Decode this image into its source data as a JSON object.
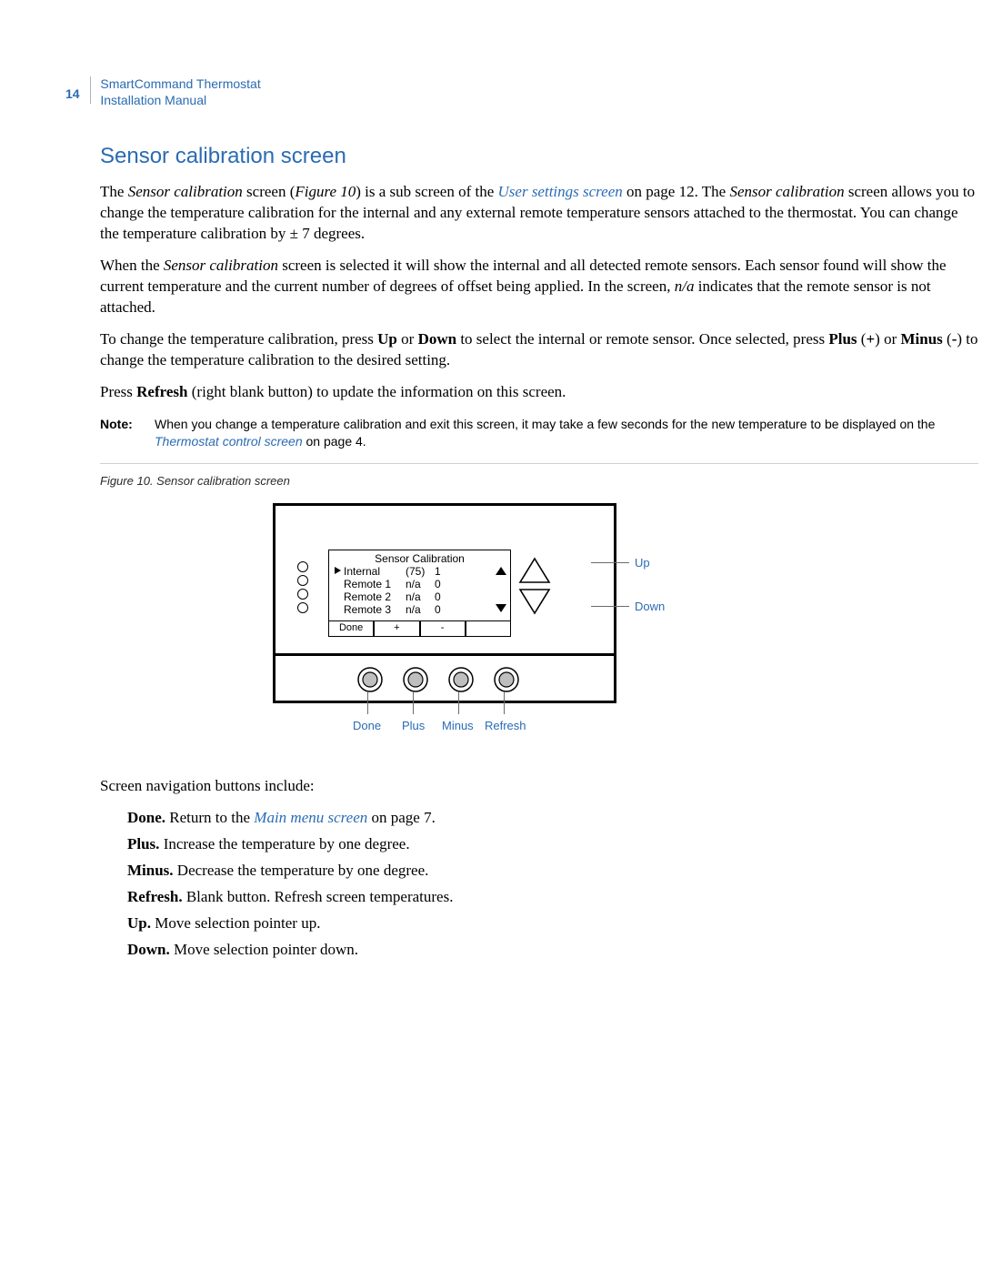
{
  "header": {
    "page_number": "14",
    "product": "SmartCommand Thermostat",
    "doc_title": "Installation Manual"
  },
  "section_title": "Sensor calibration screen",
  "para1": {
    "a": "The ",
    "i1": "Sensor calibration",
    "b": " screen (",
    "i2": "Figure 10",
    "c": ") is a sub screen of the ",
    "link": "User settings screen",
    "d": " on page 12. The ",
    "i3": "Sensor calibration",
    "e": " screen allows you to change the temperature calibration for the internal and any external remote temperature sensors attached to the thermostat. You can change the temperature calibration by ± 7 degrees."
  },
  "para2": {
    "a": "When the ",
    "i1": "Sensor calibration",
    "b": " screen is selected it will show the internal and all detected remote sensors. Each sensor found will show the current temperature and the current number of degrees of offset being applied. In the screen, ",
    "i2": "n/a",
    "c": " indicates that the remote sensor is not attached."
  },
  "para3": {
    "a": "To change the temperature calibration, press ",
    "s1": "Up",
    "b": " or ",
    "s2": "Down",
    "c": " to select the internal or remote sensor. Once selected, press ",
    "s3": "Plus",
    "d": " (",
    "s4": "+",
    "e": ") or ",
    "s5": "Minus",
    "f": " (",
    "s6": "-",
    "g": ") to change the temperature calibration to the desired setting."
  },
  "para4": {
    "a": "Press ",
    "s1": "Refresh",
    "b": " (right blank button) to update the information on this screen."
  },
  "note": {
    "label": "Note:",
    "a": "When you change a temperature calibration and exit this screen, it may take a few seconds for the new temperature to be displayed on the ",
    "link": "Thermostat control screen",
    "b": " on page 4."
  },
  "figure_caption": "Figure 10.  Sensor calibration screen",
  "lcd": {
    "title": "Sensor Calibration",
    "rows": [
      {
        "name": "Internal",
        "value": "(75)",
        "offset": "1",
        "selected": true
      },
      {
        "name": "Remote 1",
        "value": "n/a",
        "offset": "0",
        "selected": false
      },
      {
        "name": "Remote 2",
        "value": "n/a",
        "offset": "0",
        "selected": false
      },
      {
        "name": "Remote 3",
        "value": "n/a",
        "offset": "0",
        "selected": false
      }
    ],
    "softkeys": [
      "Done",
      "+",
      "-",
      ""
    ]
  },
  "callouts": {
    "up": "Up",
    "down": "Down",
    "done": "Done",
    "plus": "Plus",
    "minus": "Minus",
    "refresh": "Refresh"
  },
  "nav_lead": "Screen navigation buttons include:",
  "nav": [
    {
      "term": "Done.",
      "body_a": "  Return to the ",
      "link": "Main menu screen",
      "body_b": " on page 7."
    },
    {
      "term": "Plus.",
      "body_a": "  Increase the temperature by one degree.",
      "link": "",
      "body_b": ""
    },
    {
      "term": "Minus.",
      "body_a": "  Decrease the temperature by one degree.",
      "link": "",
      "body_b": ""
    },
    {
      "term": "Refresh.",
      "body_a": "  Blank button. Refresh screen temperatures.",
      "link": "",
      "body_b": ""
    },
    {
      "term": "Up.",
      "body_a": "  Move selection pointer up.",
      "link": "",
      "body_b": ""
    },
    {
      "term": "Down.",
      "body_a": "  Move selection pointer down.",
      "link": "",
      "body_b": ""
    }
  ]
}
